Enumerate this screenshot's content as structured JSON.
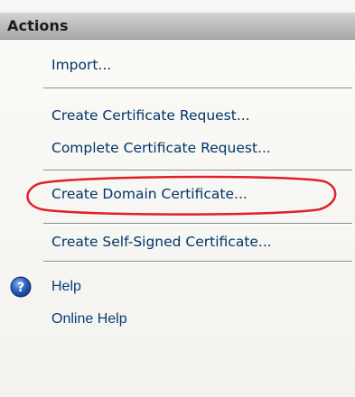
{
  "panel": {
    "title": "Actions"
  },
  "actions": {
    "import": "Import...",
    "create_cert_request": "Create Certificate Request...",
    "complete_cert_request": "Complete Certificate Request...",
    "create_domain_cert": "Create Domain Certificate...",
    "create_self_signed": "Create Self-Signed Certificate..."
  },
  "help": {
    "help_label": "Help",
    "online_help_label": "Online Help",
    "icon": "help-question-icon"
  },
  "colors": {
    "link": "#00356a",
    "highlight_ring": "#e0202a",
    "header_bg": "#bdbdbd"
  }
}
